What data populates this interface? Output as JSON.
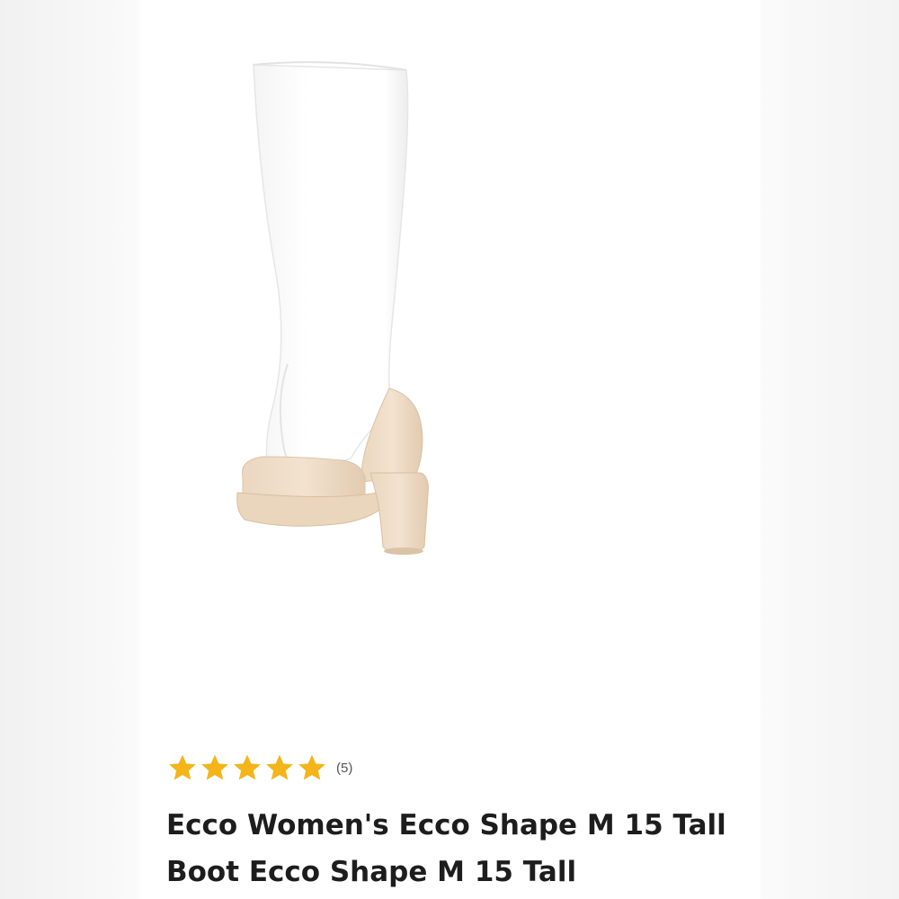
{
  "product": {
    "image_alt": "white tall boot with beige heel",
    "rating": {
      "stars_filled": 5,
      "stars_total": 5,
      "count_label": "(5)",
      "star_color": "#F3B51A"
    },
    "title": "Ecco Women's Ecco Shape M 15 Tall Boot Ecco Shape M 15 Tall"
  }
}
